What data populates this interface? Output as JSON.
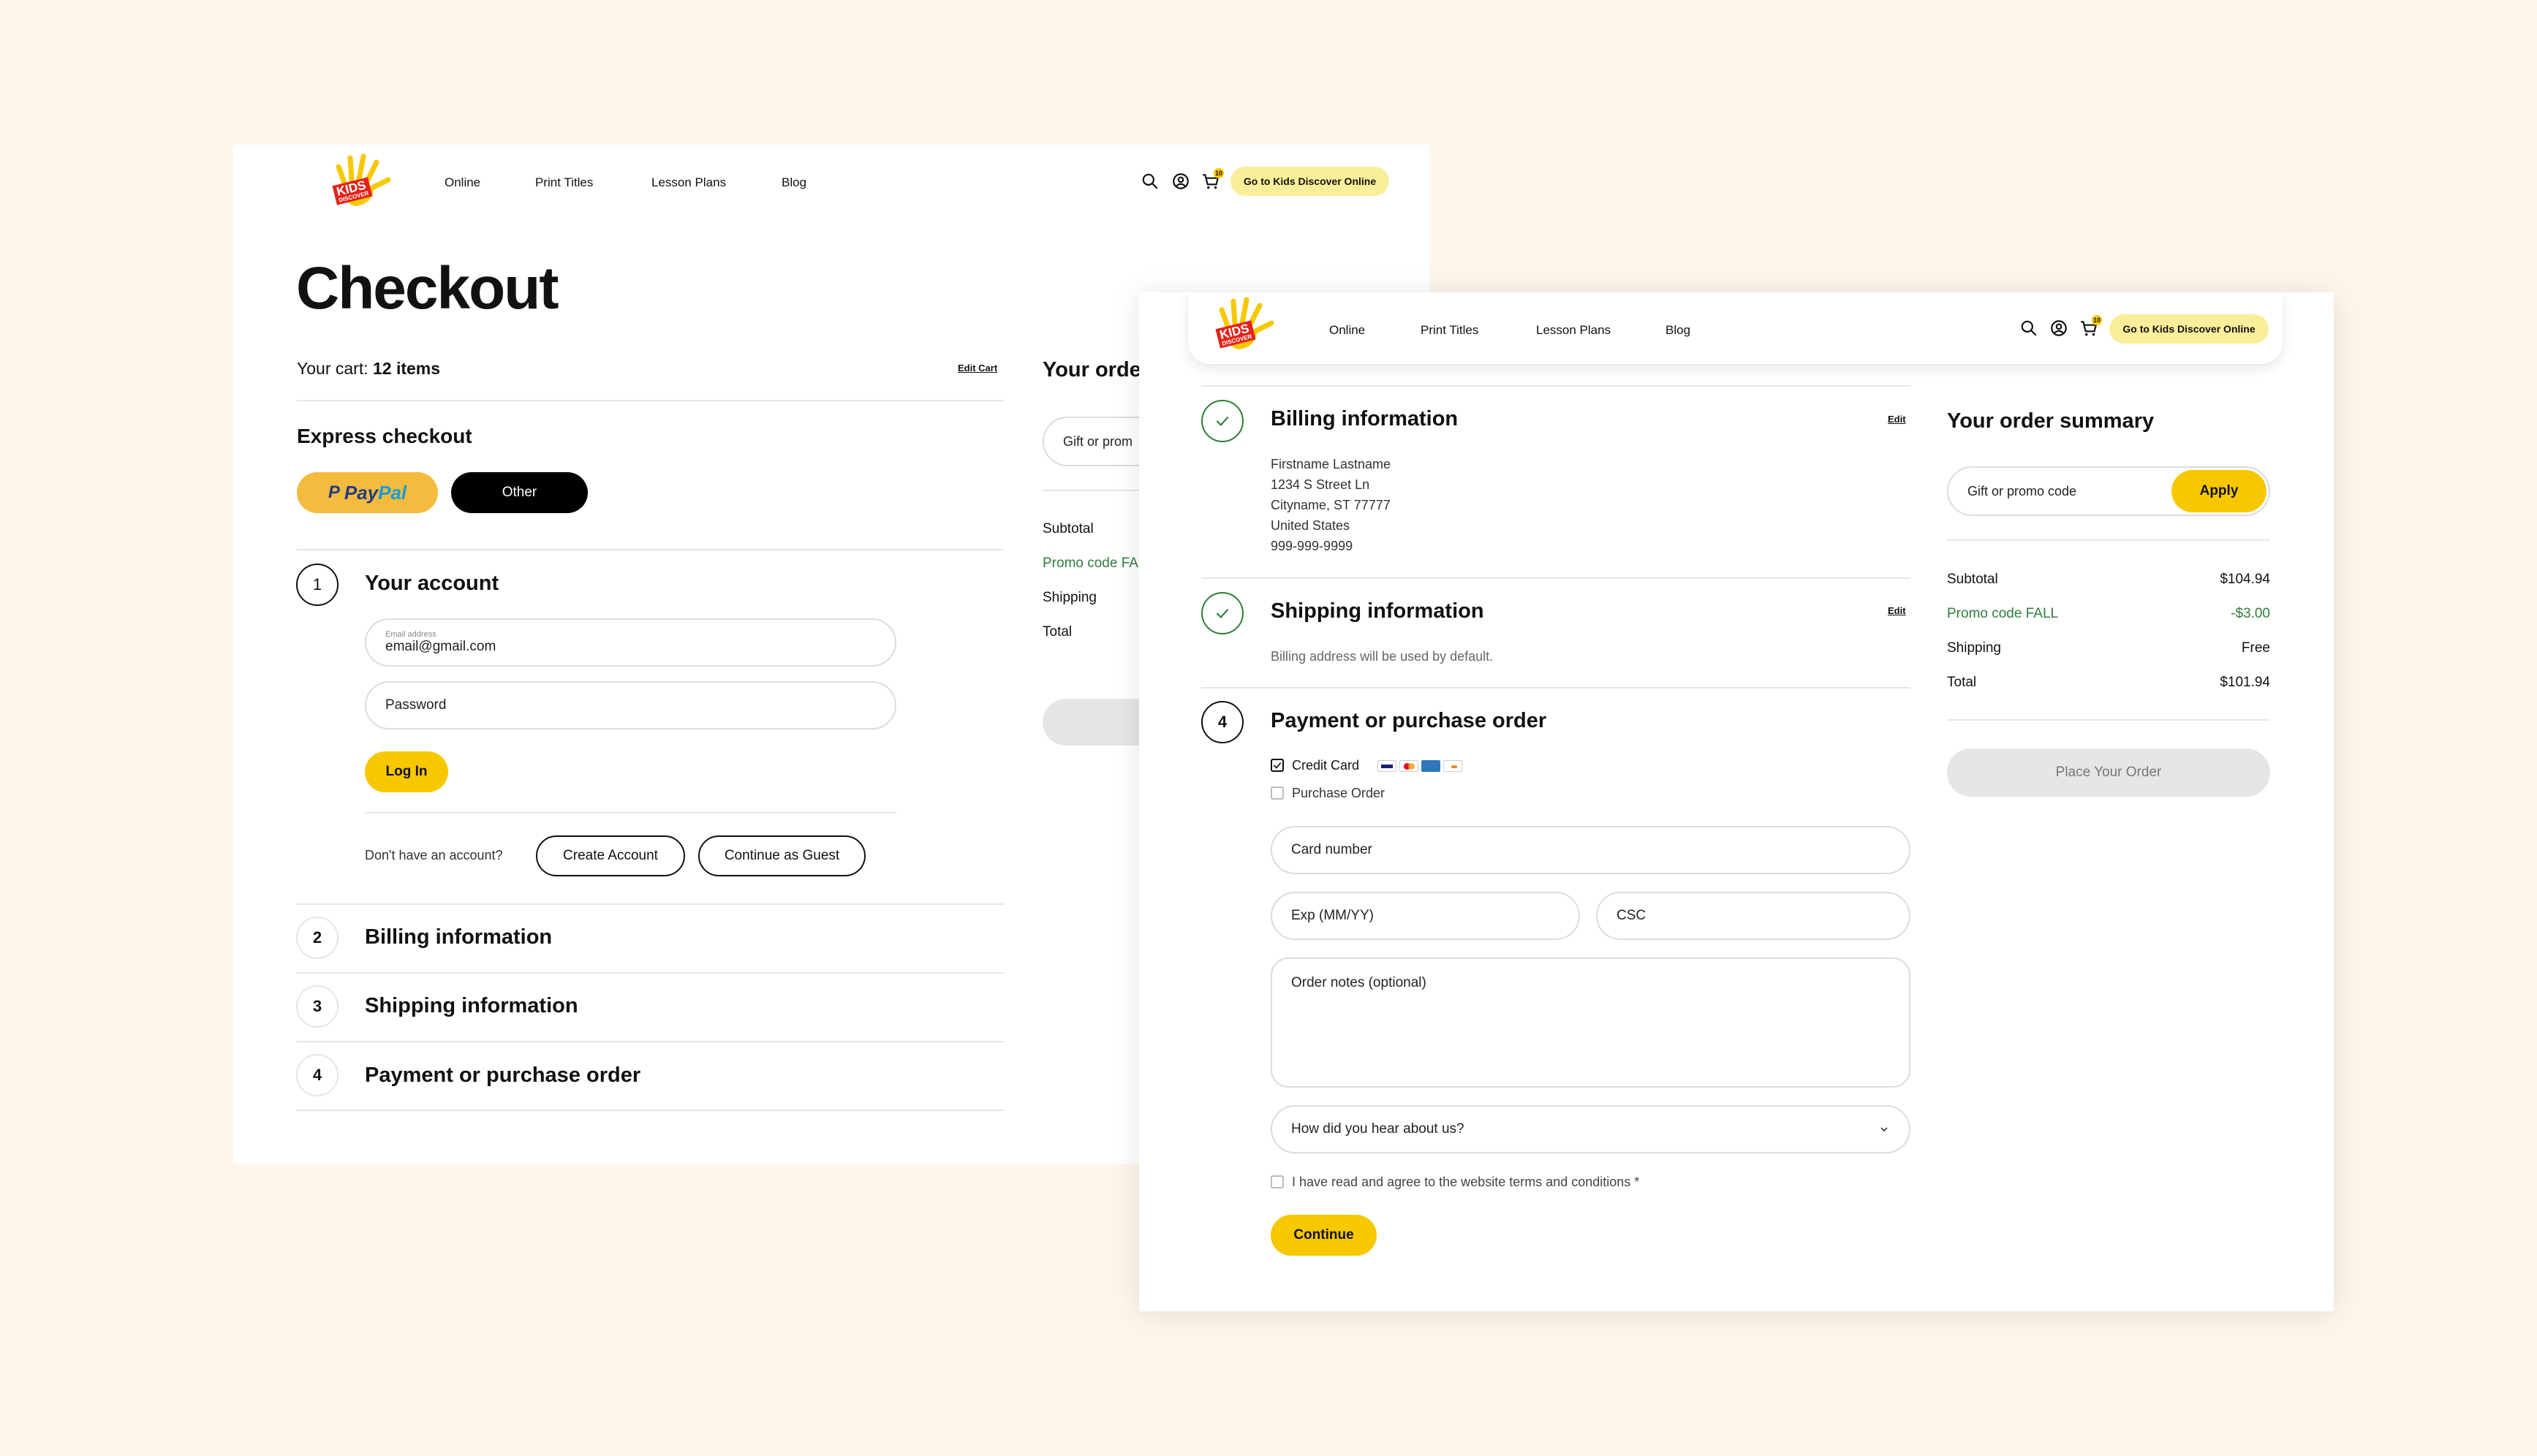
{
  "nav": {
    "brand_line1": "KIDS",
    "brand_line2": "DISCOVER",
    "links": [
      "Online",
      "Print Titles",
      "Lesson Plans",
      "Blog"
    ],
    "cart_count": "10",
    "cta": "Go to Kids Discover Online",
    "icons": [
      "search-icon",
      "account-icon",
      "cart-icon"
    ]
  },
  "screen_a": {
    "title": "Checkout",
    "cart_label": "Your cart: ",
    "cart_count": "12 items",
    "edit_cart": "Edit Cart",
    "express_title": "Express checkout",
    "paypal_pay": "Pay",
    "paypal_pal": "Pal",
    "other_label": "Other",
    "steps": [
      {
        "number": "1",
        "title": "Your account"
      },
      {
        "number": "2",
        "title": "Billing information"
      },
      {
        "number": "3",
        "title": "Shipping information"
      },
      {
        "number": "4",
        "title": "Payment or purchase order"
      }
    ],
    "email_label": "Email address",
    "email_value": "email@gmail.com",
    "password_placeholder": "Password",
    "login_label": "Log In",
    "no_account_text": "Don't have an account?",
    "create_account": "Create Account",
    "continue_guest": "Continue as Guest",
    "summary_title": "Your orde",
    "promo_placeholder": "Gift or prom",
    "summary_rows": [
      "Subtotal",
      "Promo code FA",
      "Shipping",
      "Total"
    ]
  },
  "screen_b": {
    "billing": {
      "title": "Billing information",
      "edit": "Edit",
      "lines": [
        "Firstname Lastname",
        "1234 S Street Ln",
        "Cityname, ST 77777",
        "United States",
        "999-999-9999"
      ]
    },
    "shipping": {
      "title": "Shipping information",
      "edit": "Edit",
      "note": "Billing address will be used by default."
    },
    "payment": {
      "number": "4",
      "title": "Payment or purchase order",
      "option_credit": "Credit Card",
      "option_po": "Purchase Order",
      "card_number_placeholder": "Card number",
      "exp_placeholder": "Exp (MM/YY)",
      "csc_placeholder": "CSC",
      "notes_placeholder": "Order notes (optional)",
      "hear_placeholder": "How did you hear about us?",
      "terms": "I have read and agree to the website terms and conditions *",
      "continue": "Continue"
    },
    "summary": {
      "title": "Your order summary",
      "promo_placeholder": "Gift or promo code",
      "apply": "Apply",
      "rows": [
        {
          "label": "Subtotal",
          "value": "$104.94"
        },
        {
          "label": "Promo code FALL",
          "value": "-$3.00"
        },
        {
          "label": "Shipping",
          "value": "Free"
        },
        {
          "label": "Total",
          "value": "$101.94"
        }
      ],
      "place_order": "Place Your Order"
    }
  },
  "colors": {
    "background": "#fdf6ec",
    "accent_yellow": "#f7c800",
    "paypal_yellow": "#f4bb3f",
    "success_green": "#2e7d3b",
    "brand_red": "#e2231a"
  }
}
